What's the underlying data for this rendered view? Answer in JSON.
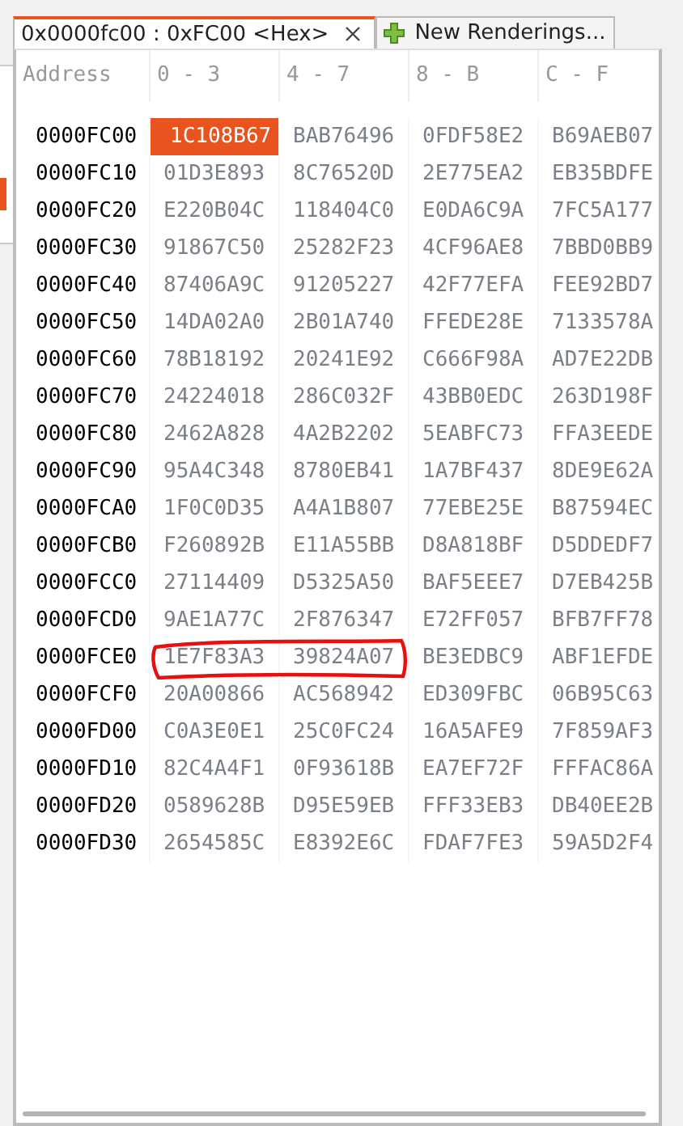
{
  "tabs": [
    {
      "label": "0x0000fc00 : 0xFC00 <Hex>",
      "selected": true,
      "closable": true,
      "kind": "view"
    },
    {
      "label": "New Renderings...",
      "selected": false,
      "closable": false,
      "kind": "add"
    }
  ],
  "columns": [
    "Address",
    "0 - 3",
    "4 - 7",
    "8 - B",
    "C - F"
  ],
  "rows": [
    {
      "address": "0000FC00",
      "cells": [
        {
          "text": "1C108B67",
          "selected": true,
          "circled": false
        },
        {
          "text": "BAB76496",
          "selected": false,
          "circled": false
        },
        {
          "text": "0FDF58E2",
          "selected": false,
          "circled": false
        },
        {
          "text": "B69AEB07",
          "selected": false,
          "circled": false
        }
      ]
    },
    {
      "address": "0000FC10",
      "cells": [
        {
          "text": "01D3E893",
          "selected": false,
          "circled": false
        },
        {
          "text": "8C76520D",
          "selected": false,
          "circled": false
        },
        {
          "text": "2E775EA2",
          "selected": false,
          "circled": false
        },
        {
          "text": "EB35BDFE",
          "selected": false,
          "circled": false
        }
      ]
    },
    {
      "address": "0000FC20",
      "cells": [
        {
          "text": "E220B04C",
          "selected": false,
          "circled": false
        },
        {
          "text": "118404C0",
          "selected": false,
          "circled": false
        },
        {
          "text": "E0DA6C9A",
          "selected": false,
          "circled": false
        },
        {
          "text": "7FC5A177",
          "selected": false,
          "circled": false
        }
      ]
    },
    {
      "address": "0000FC30",
      "cells": [
        {
          "text": "91867C50",
          "selected": false,
          "circled": false
        },
        {
          "text": "25282F23",
          "selected": false,
          "circled": false
        },
        {
          "text": "4CF96AE8",
          "selected": false,
          "circled": false
        },
        {
          "text": "7BBD0BB9",
          "selected": false,
          "circled": false
        }
      ]
    },
    {
      "address": "0000FC40",
      "cells": [
        {
          "text": "87406A9C",
          "selected": false,
          "circled": false
        },
        {
          "text": "91205227",
          "selected": false,
          "circled": false
        },
        {
          "text": "42F77EFA",
          "selected": false,
          "circled": false
        },
        {
          "text": "FEE92BD7",
          "selected": false,
          "circled": false
        }
      ]
    },
    {
      "address": "0000FC50",
      "cells": [
        {
          "text": "14DA02A0",
          "selected": false,
          "circled": false
        },
        {
          "text": "2B01A740",
          "selected": false,
          "circled": false
        },
        {
          "text": "FFEDE28E",
          "selected": false,
          "circled": false
        },
        {
          "text": "7133578A",
          "selected": false,
          "circled": false
        }
      ]
    },
    {
      "address": "0000FC60",
      "cells": [
        {
          "text": "78B18192",
          "selected": false,
          "circled": false
        },
        {
          "text": "20241E92",
          "selected": false,
          "circled": false
        },
        {
          "text": "C666F98A",
          "selected": false,
          "circled": false
        },
        {
          "text": "AD7E22DB",
          "selected": false,
          "circled": false
        }
      ]
    },
    {
      "address": "0000FC70",
      "cells": [
        {
          "text": "24224018",
          "selected": false,
          "circled": false
        },
        {
          "text": "286C032F",
          "selected": false,
          "circled": false
        },
        {
          "text": "43BB0EDC",
          "selected": false,
          "circled": false
        },
        {
          "text": "263D198F",
          "selected": false,
          "circled": false
        }
      ]
    },
    {
      "address": "0000FC80",
      "cells": [
        {
          "text": "2462A828",
          "selected": false,
          "circled": false
        },
        {
          "text": "4A2B2202",
          "selected": false,
          "circled": false
        },
        {
          "text": "5EABFC73",
          "selected": false,
          "circled": false
        },
        {
          "text": "FFA3EEDE",
          "selected": false,
          "circled": false
        }
      ]
    },
    {
      "address": "0000FC90",
      "cells": [
        {
          "text": "95A4C348",
          "selected": false,
          "circled": false
        },
        {
          "text": "8780EB41",
          "selected": false,
          "circled": false
        },
        {
          "text": "1A7BF437",
          "selected": false,
          "circled": false
        },
        {
          "text": "8DE9E62A",
          "selected": false,
          "circled": false
        }
      ]
    },
    {
      "address": "0000FCA0",
      "cells": [
        {
          "text": "1F0C0D35",
          "selected": false,
          "circled": false
        },
        {
          "text": "A4A1B807",
          "selected": false,
          "circled": false
        },
        {
          "text": "77EBE25E",
          "selected": false,
          "circled": false
        },
        {
          "text": "B87594EC",
          "selected": false,
          "circled": false
        }
      ]
    },
    {
      "address": "0000FCB0",
      "cells": [
        {
          "text": "F260892B",
          "selected": false,
          "circled": false
        },
        {
          "text": "E11A55BB",
          "selected": false,
          "circled": false
        },
        {
          "text": "D8A818BF",
          "selected": false,
          "circled": false
        },
        {
          "text": "D5DDEDF7",
          "selected": false,
          "circled": false
        }
      ]
    },
    {
      "address": "0000FCC0",
      "cells": [
        {
          "text": "27114409",
          "selected": false,
          "circled": false
        },
        {
          "text": "D5325A50",
          "selected": false,
          "circled": false
        },
        {
          "text": "BAF5EEE7",
          "selected": false,
          "circled": false
        },
        {
          "text": "D7EB425B",
          "selected": false,
          "circled": false
        }
      ]
    },
    {
      "address": "0000FCD0",
      "cells": [
        {
          "text": "9AE1A77C",
          "selected": false,
          "circled": false
        },
        {
          "text": "2F876347",
          "selected": false,
          "circled": false
        },
        {
          "text": "E72FF057",
          "selected": false,
          "circled": false
        },
        {
          "text": "BFB7FF78",
          "selected": false,
          "circled": false
        }
      ]
    },
    {
      "address": "0000FCE0",
      "cells": [
        {
          "text": "1E7F83A3",
          "selected": false,
          "circled": true
        },
        {
          "text": "39824A07",
          "selected": false,
          "circled": true
        },
        {
          "text": "BE3EDBC9",
          "selected": false,
          "circled": false
        },
        {
          "text": "ABF1EFDE",
          "selected": false,
          "circled": false
        }
      ]
    },
    {
      "address": "0000FCF0",
      "cells": [
        {
          "text": "20A00866",
          "selected": false,
          "circled": false
        },
        {
          "text": "AC568942",
          "selected": false,
          "circled": false
        },
        {
          "text": "ED309FBC",
          "selected": false,
          "circled": false
        },
        {
          "text": "06B95C63",
          "selected": false,
          "circled": false
        }
      ]
    },
    {
      "address": "0000FD00",
      "cells": [
        {
          "text": "C0A3E0E1",
          "selected": false,
          "circled": false
        },
        {
          "text": "25C0FC24",
          "selected": false,
          "circled": false
        },
        {
          "text": "16A5AFE9",
          "selected": false,
          "circled": false
        },
        {
          "text": "7F859AF3",
          "selected": false,
          "circled": false
        }
      ]
    },
    {
      "address": "0000FD10",
      "cells": [
        {
          "text": "82C4A4F1",
          "selected": false,
          "circled": false
        },
        {
          "text": "0F93618B",
          "selected": false,
          "circled": false
        },
        {
          "text": "EA7EF72F",
          "selected": false,
          "circled": false
        },
        {
          "text": "FFFAC86A",
          "selected": false,
          "circled": false
        }
      ]
    },
    {
      "address": "0000FD20",
      "cells": [
        {
          "text": "0589628B",
          "selected": false,
          "circled": false
        },
        {
          "text": "D95E59EB",
          "selected": false,
          "circled": false
        },
        {
          "text": "FFF33EB3",
          "selected": false,
          "circled": false
        },
        {
          "text": "DB40EE2B",
          "selected": false,
          "circled": false
        }
      ]
    },
    {
      "address": "0000FD30",
      "cells": [
        {
          "text": "2654585C",
          "selected": false,
          "circled": false
        },
        {
          "text": "E8392E6C",
          "selected": false,
          "circled": false
        },
        {
          "text": "FDAF7FE3",
          "selected": false,
          "circled": false
        },
        {
          "text": "59A5D2F4",
          "selected": false,
          "circled": false
        }
      ]
    }
  ]
}
